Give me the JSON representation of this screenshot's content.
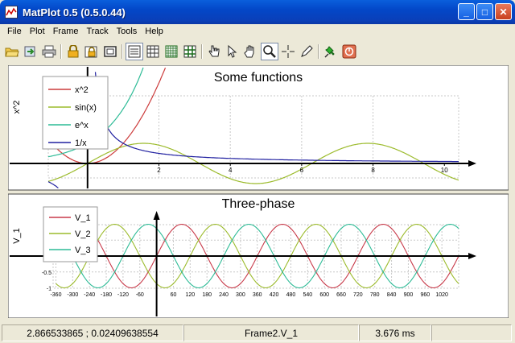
{
  "window": {
    "title": "MatPlot 0.5 (0.5.0.44)",
    "buttons": {
      "minimize": "_",
      "maximize": "□",
      "close": "✕"
    }
  },
  "menu": [
    "File",
    "Plot",
    "Frame",
    "Track",
    "Tools",
    "Help"
  ],
  "toolbar": [
    "open-folder-icon",
    "import-icon",
    "print-icon",
    "lock-icon",
    "lock-frame-icon",
    "frame-icon",
    "grid-off-icon",
    "grid-major-icon",
    "grid-minor-icon",
    "grid-both-icon",
    "hand-point-icon",
    "pointer-icon",
    "pan-hand-icon",
    "zoom-icon",
    "crosshair-icon",
    "pen-icon",
    "pin-icon",
    "stop-icon"
  ],
  "frames": [
    {
      "title": "Some functions",
      "ylabel": "x^2",
      "legend": [
        {
          "label": "x^2",
          "color": "#cc3b3b"
        },
        {
          "label": "sin(x)",
          "color": "#9cbb2c"
        },
        {
          "label": "e^x",
          "color": "#2dbb96"
        },
        {
          "label": "1/x",
          "color": "#2020a0"
        }
      ],
      "xticks": [
        "2",
        "4",
        "6",
        "8",
        "10"
      ],
      "xrange": [
        -1.1,
        10.4
      ]
    },
    {
      "title": "Three-phase",
      "ylabel": "V_1",
      "legend": [
        {
          "label": "V_1",
          "color": "#c83a4a"
        },
        {
          "label": "V_2",
          "color": "#9cbb2c"
        },
        {
          "label": "V_3",
          "color": "#2dbb96"
        }
      ],
      "yticks": [
        "-0.5",
        "-1"
      ],
      "xticks": [
        "-360",
        "-300",
        "-240",
        "-180",
        "-120",
        "-60",
        "60",
        "120",
        "180",
        "240",
        "300",
        "360",
        "420",
        "480",
        "540",
        "600",
        "660",
        "720",
        "780",
        "840",
        "900",
        "960",
        "1020"
      ],
      "xrange": [
        -370,
        1080
      ]
    }
  ],
  "status": {
    "coords": "2.866533865 ; 0.02409638554",
    "series": "Frame2.V_1",
    "time": "3.676 ms"
  },
  "colors": {
    "plot_bg": "#ffffff",
    "frame_bg": "#ffffff",
    "grid": "#c8c8c8"
  }
}
